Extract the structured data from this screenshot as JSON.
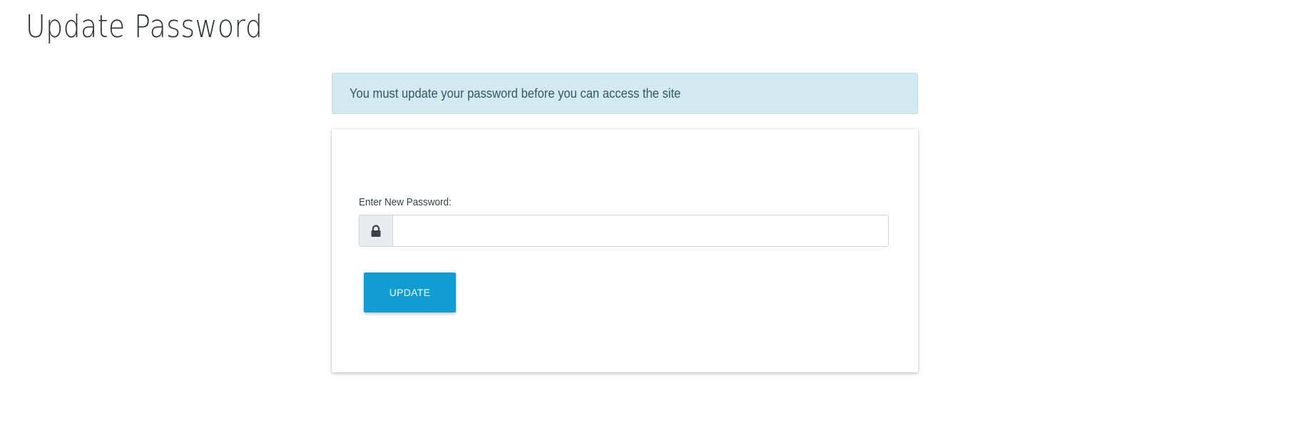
{
  "page": {
    "title": "Update Password"
  },
  "alert": {
    "message": "You must update your password before you can access the site"
  },
  "form": {
    "password_label": "Enter New Password:",
    "password_value": "",
    "lock_icon": "lock-icon",
    "submit_label": "UPDATE"
  },
  "colors": {
    "alert_background": "#d1e9ef",
    "alert_text": "#31586a",
    "button_background": "#119dd4",
    "button_text": "#ffffff"
  }
}
